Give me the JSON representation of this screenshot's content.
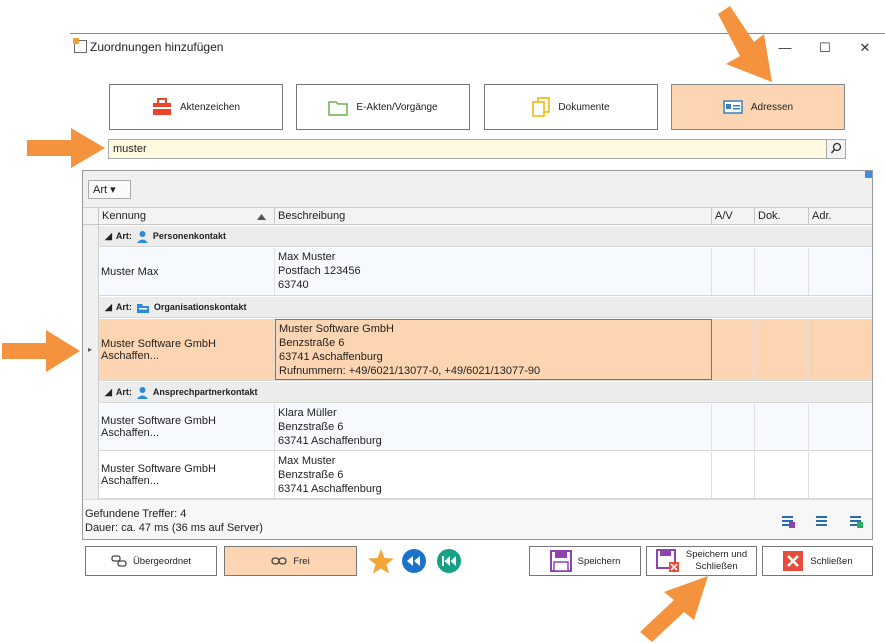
{
  "window": {
    "title": "Zuordnungen hinzufügen",
    "minimize": "—",
    "maximize": "☐",
    "close": "✕"
  },
  "tabs": [
    {
      "label": "Aktenzeichen",
      "icon": "toolbox-icon"
    },
    {
      "label": "E-Akten/Vorgänge",
      "icon": "folder-icon"
    },
    {
      "label": "Dokumente",
      "icon": "documents-icon"
    },
    {
      "label": "Adressen",
      "icon": "address-card-icon",
      "active": true
    }
  ],
  "search": {
    "value": "muster"
  },
  "filter": {
    "label": "Art ▾"
  },
  "columns": {
    "kennung": "Kennung",
    "beschreibung": "Beschreibung",
    "av": "A/V",
    "dok": "Dok.",
    "adr": "Adr."
  },
  "groups": [
    {
      "prefix": "Art:",
      "label": "Personenkontakt"
    },
    {
      "prefix": "Art:",
      "label": "Organisationskontakt"
    },
    {
      "prefix": "Art:",
      "label": "Ansprechpartnerkontakt"
    }
  ],
  "rows": [
    {
      "kennung": "Muster Max",
      "lines": [
        "Max Muster",
        "Postfach 123456",
        "63740"
      ]
    },
    {
      "kennung": "Muster Software GmbH Aschaffen...",
      "lines": [
        "Muster Software GmbH",
        "Benzstraße 6",
        "63741 Aschaffenburg",
        "Rufnummern: +49/6021/13077-0, +49/6021/13077-90"
      ]
    },
    {
      "kennung": "Muster Software GmbH Aschaffen...",
      "lines": [
        "Klara Müller",
        "Benzstraße 6",
        "63741 Aschaffenburg"
      ]
    },
    {
      "kennung": "Muster Software GmbH Aschaffen...",
      "lines": [
        "Max Muster",
        "Benzstraße 6",
        "63741 Aschaffenburg"
      ]
    }
  ],
  "status": {
    "found": "Gefundene Treffer: 4",
    "duration": "Dauer: ca. 47 ms (36 ms auf Server)"
  },
  "buttons": {
    "parent": "Übergeordnet",
    "free": "Frei",
    "save": "Speichern",
    "save_close_1": "Speichern und",
    "save_close_2": "Schließen",
    "close": "Schließen"
  },
  "colors": {
    "accent": "#fdd5b3",
    "arrow": "#f5923e",
    "blue": "#1a73c9"
  }
}
